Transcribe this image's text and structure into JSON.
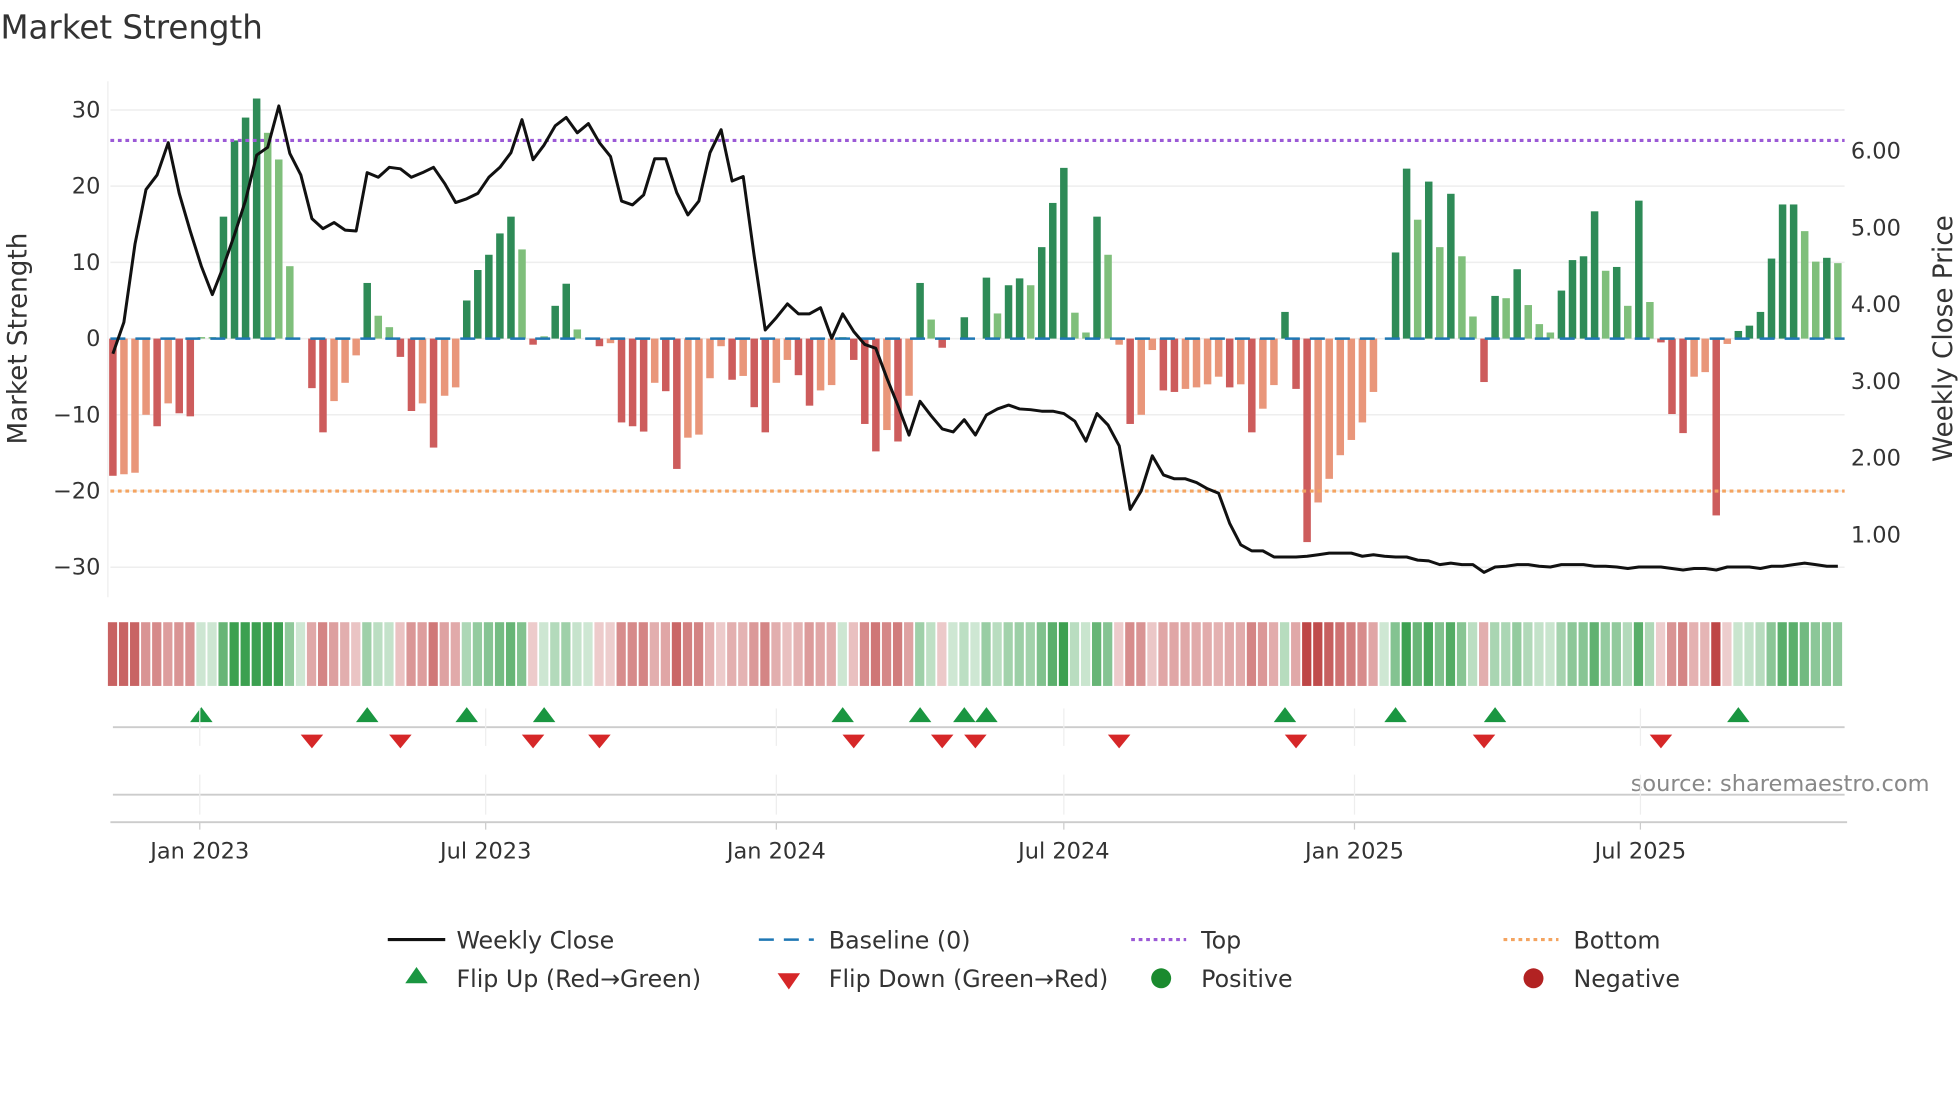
{
  "chart_data": {
    "type": "bar",
    "title": "Market Strength",
    "ylabel": "Market Strength",
    "y2label": "Weekly Close Price",
    "ylim": [
      -33,
      33
    ],
    "y2lim": [
      0.3,
      6.9
    ],
    "yticks": [
      "30",
      "20",
      "10",
      "0",
      "−10",
      "−20",
      "−30"
    ],
    "ytick_values": [
      30,
      20,
      10,
      0,
      -10,
      -20,
      -30
    ],
    "y2ticks": [
      "6.00",
      "5.00",
      "4.00",
      "3.00",
      "2.00",
      "1.00"
    ],
    "y2tick_values": [
      6,
      5,
      4,
      3,
      2,
      1
    ],
    "xticks": [
      {
        "label": "Jan 2023",
        "date": "2023-01-01"
      },
      {
        "label": "Jul 2023",
        "date": "2023-07-01"
      },
      {
        "label": "Jan 2024",
        "date": "2024-01-01"
      },
      {
        "label": "Jul 2024",
        "date": "2024-07-01"
      },
      {
        "label": "Jan 2025",
        "date": "2025-01-01"
      },
      {
        "label": "Jul 2025",
        "date": "2025-07-01"
      }
    ],
    "start_date": "2022-11-07",
    "frequency": "weekly",
    "top_level": 26,
    "bottom_level": -20,
    "baseline": 0,
    "strength": [
      -18,
      -17.8,
      -17.6,
      -10,
      -11.5,
      -8.5,
      -9.8,
      -10.2,
      0.2,
      0.2,
      16,
      26,
      29,
      31.5,
      27,
      23.5,
      9.5,
      0,
      -6.5,
      -12.3,
      -8.2,
      -5.8,
      -2.2,
      7.3,
      3,
      1.5,
      -2.4,
      -9.5,
      -8.5,
      -14.3,
      -7.5,
      -6.4,
      5,
      9,
      11,
      13.8,
      16,
      11.7,
      -0.8,
      0.3,
      4.3,
      7.2,
      1.2,
      0,
      -1,
      -0.6,
      -11,
      -11.5,
      -12.2,
      -5.8,
      -6.9,
      -17.1,
      -13,
      -12.6,
      -5.2,
      -1,
      -5.4,
      -4.9,
      -9,
      -12.3,
      -5.8,
      -2.8,
      -4.8,
      -8.8,
      -6.8,
      -6.1,
      0.2,
      -2.8,
      -11.2,
      -14.8,
      -12,
      -13.5,
      -7.5,
      7.3,
      2.5,
      -1.2,
      0,
      2.8,
      0,
      8,
      3.3,
      7,
      7.9,
      7,
      12,
      17.8,
      22.4,
      3.4,
      0.8,
      16,
      11,
      -0.8,
      -11.2,
      -10,
      -1.5,
      -6.8,
      -7,
      -6.6,
      -6.4,
      -6,
      -5,
      -6.4,
      -6,
      -12.3,
      -9.2,
      -6.1,
      3.5,
      -6.6,
      -26.7,
      -21.5,
      -18.4,
      -15.3,
      -13.3,
      -11,
      -7,
      0,
      11.3,
      22.3,
      15.6,
      20.6,
      12,
      19,
      10.8,
      2.9,
      -5.7,
      5.6,
      5.3,
      9.1,
      4.4,
      1.9,
      0.8,
      6.3,
      10.3,
      10.8,
      16.7,
      8.9,
      9.4,
      4.3,
      18.1,
      4.8,
      -0.5,
      -9.9,
      -12.4,
      -5,
      -4.4,
      -23.2,
      -0.7,
      1,
      1.7,
      3.5,
      10.5,
      17.6,
      17.6,
      14.1,
      10.1,
      10.6,
      9.9
    ],
    "shade": "dllldlddllddddllllddllldllddldlldddddldlddlldldddlddlllldldd llddlllddd ldldldldld lddldddlld lldllddlll ldldlldddl llllllddld ldllddldll lddddldldl dddlldlddd dddlldl",
    "weekly_close": [
      3.36,
      3.77,
      4.79,
      5.5,
      5.69,
      6.11,
      5.45,
      4.96,
      4.5,
      4.13,
      4.5,
      4.91,
      5.36,
      5.95,
      6.05,
      6.59,
      5.97,
      5.69,
      5.12,
      4.99,
      5.07,
      4.97,
      4.96,
      5.72,
      5.66,
      5.79,
      5.77,
      5.66,
      5.72,
      5.79,
      5.58,
      5.33,
      5.38,
      5.45,
      5.66,
      5.79,
      5.98,
      6.41,
      5.89,
      6.08,
      6.33,
      6.44,
      6.24,
      6.36,
      6.11,
      5.93,
      5.35,
      5.3,
      5.43,
      5.9,
      5.9,
      5.46,
      5.17,
      5.35,
      5.98,
      6.28,
      5.61,
      5.67,
      4.63,
      3.67,
      3.83,
      4.01,
      3.88,
      3.88,
      3.96,
      3.56,
      3.88,
      3.65,
      3.48,
      3.43,
      3.04,
      2.68,
      2.3,
      2.74,
      2.55,
      2.38,
      2.34,
      2.5,
      2.3,
      2.56,
      2.64,
      2.69,
      2.64,
      2.63,
      2.61,
      2.61,
      2.58,
      2.48,
      2.22,
      2.58,
      2.43,
      2.16,
      1.33,
      1.57,
      2.03,
      1.78,
      1.73,
      1.73,
      1.68,
      1.6,
      1.54,
      1.15,
      0.87,
      0.79,
      0.79,
      0.71,
      0.71,
      0.71,
      0.72,
      0.74,
      0.76,
      0.76,
      0.76,
      0.72,
      0.74,
      0.72,
      0.71,
      0.71,
      0.67,
      0.66,
      0.61,
      0.63,
      0.61,
      0.61,
      0.51,
      0.58,
      0.59,
      0.61,
      0.61,
      0.59,
      0.58,
      0.61,
      0.61,
      0.61,
      0.59,
      0.59,
      0.58,
      0.56,
      0.58,
      0.58,
      0.58,
      0.56,
      0.54,
      0.56,
      0.56,
      0.54,
      0.58,
      0.58,
      0.58,
      0.56,
      0.59,
      0.59,
      0.61,
      0.63,
      0.61,
      0.59,
      0.59
    ],
    "flip_up_weeks": [
      8,
      23,
      32,
      39,
      66,
      73,
      77,
      79,
      106,
      116,
      125,
      147
    ],
    "flip_down_weeks": [
      18,
      26,
      38,
      44,
      67,
      75,
      78,
      91,
      107,
      124,
      140
    ],
    "legend_placement": "bottom",
    "legend": {
      "weekly_close": "Weekly Close",
      "baseline": "Baseline (0)",
      "top": "Top",
      "bottom": "Bottom",
      "flip_up": "Flip Up (Red→Green)",
      "flip_down": "Flip Down (Green→Red)",
      "positive": "Positive",
      "negative": "Negative"
    },
    "source": "source: sharemaestro.com"
  },
  "colors": {
    "green_dark": "#2e8b57",
    "green_light": "#7fbf7b",
    "red_dark": "#cd5c5c",
    "red_light": "#e9967a",
    "line": "#111111",
    "baseline": "#1f77b4",
    "top": "#9b59d6",
    "bottom": "#f4a460",
    "flip_up": "#1a9641",
    "flip_down": "#d62728",
    "positive": "#1a8a2e",
    "negative": "#b22222"
  }
}
